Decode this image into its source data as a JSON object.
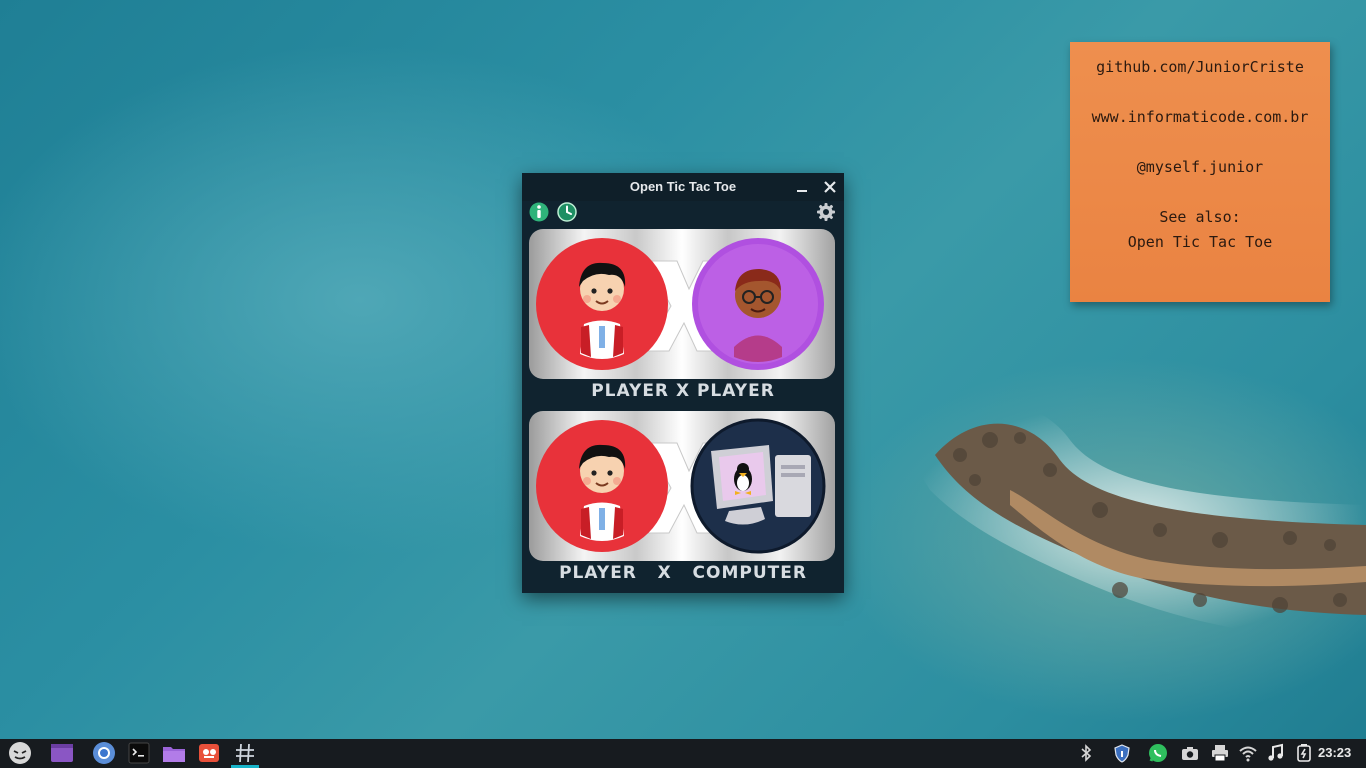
{
  "desktop": {
    "sticky_note": {
      "lines": [
        "github.com/JuniorCriste",
        "www.informaticode.com.br",
        "@myself.junior",
        "See also:",
        "Open Tic Tac Toe"
      ]
    }
  },
  "window": {
    "title": "Open Tic Tac Toe",
    "toolbar": {
      "left_icons": [
        "info-icon",
        "history-clock-icon"
      ],
      "right_icons": [
        "settings-gear-icon"
      ]
    },
    "modes": [
      {
        "label": "PLAYER X PLAYER",
        "left_avatar": "boy-player-avatar",
        "right_avatar": "glasses-player-avatar"
      },
      {
        "label": "PLAYER   X   COMPUTER",
        "left_avatar": "boy-player-avatar",
        "right_avatar": "tux-computer-avatar"
      }
    ]
  },
  "taskbar": {
    "apps": [
      "app-menu-icon",
      "show-desktop-icon",
      "chromium-icon",
      "terminal-icon",
      "file-manager-icon",
      "screenshot-tool-icon",
      "tic-tac-toe-icon"
    ],
    "tray": [
      "bluetooth-icon",
      "security-shield-icon",
      "whatsapp-icon",
      "camera-icon",
      "printer-icon",
      "wifi-icon",
      "music-icon",
      "battery-icon"
    ],
    "clock": "23:23"
  },
  "colors": {
    "accent": "#18b4c9",
    "window_bg": "#10232f",
    "note_bg": "#ea8342",
    "player_red": "#e8323a",
    "player_purple": "#b050e0"
  }
}
